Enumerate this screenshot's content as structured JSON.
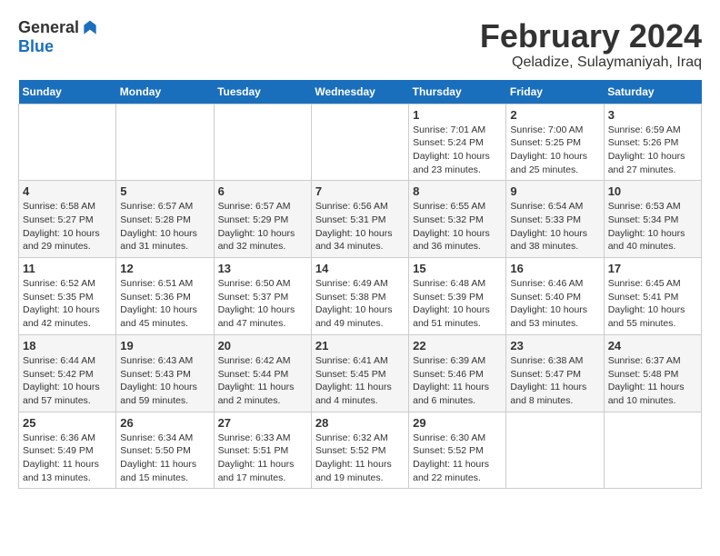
{
  "header": {
    "logo_general": "General",
    "logo_blue": "Blue",
    "month_title": "February 2024",
    "location": "Qeladize, Sulaymaniyah, Iraq"
  },
  "days_of_week": [
    "Sunday",
    "Monday",
    "Tuesday",
    "Wednesday",
    "Thursday",
    "Friday",
    "Saturday"
  ],
  "weeks": [
    [
      {
        "day": "",
        "info": ""
      },
      {
        "day": "",
        "info": ""
      },
      {
        "day": "",
        "info": ""
      },
      {
        "day": "",
        "info": ""
      },
      {
        "day": "1",
        "info": "Sunrise: 7:01 AM\nSunset: 5:24 PM\nDaylight: 10 hours\nand 23 minutes."
      },
      {
        "day": "2",
        "info": "Sunrise: 7:00 AM\nSunset: 5:25 PM\nDaylight: 10 hours\nand 25 minutes."
      },
      {
        "day": "3",
        "info": "Sunrise: 6:59 AM\nSunset: 5:26 PM\nDaylight: 10 hours\nand 27 minutes."
      }
    ],
    [
      {
        "day": "4",
        "info": "Sunrise: 6:58 AM\nSunset: 5:27 PM\nDaylight: 10 hours\nand 29 minutes."
      },
      {
        "day": "5",
        "info": "Sunrise: 6:57 AM\nSunset: 5:28 PM\nDaylight: 10 hours\nand 31 minutes."
      },
      {
        "day": "6",
        "info": "Sunrise: 6:57 AM\nSunset: 5:29 PM\nDaylight: 10 hours\nand 32 minutes."
      },
      {
        "day": "7",
        "info": "Sunrise: 6:56 AM\nSunset: 5:31 PM\nDaylight: 10 hours\nand 34 minutes."
      },
      {
        "day": "8",
        "info": "Sunrise: 6:55 AM\nSunset: 5:32 PM\nDaylight: 10 hours\nand 36 minutes."
      },
      {
        "day": "9",
        "info": "Sunrise: 6:54 AM\nSunset: 5:33 PM\nDaylight: 10 hours\nand 38 minutes."
      },
      {
        "day": "10",
        "info": "Sunrise: 6:53 AM\nSunset: 5:34 PM\nDaylight: 10 hours\nand 40 minutes."
      }
    ],
    [
      {
        "day": "11",
        "info": "Sunrise: 6:52 AM\nSunset: 5:35 PM\nDaylight: 10 hours\nand 42 minutes."
      },
      {
        "day": "12",
        "info": "Sunrise: 6:51 AM\nSunset: 5:36 PM\nDaylight: 10 hours\nand 45 minutes."
      },
      {
        "day": "13",
        "info": "Sunrise: 6:50 AM\nSunset: 5:37 PM\nDaylight: 10 hours\nand 47 minutes."
      },
      {
        "day": "14",
        "info": "Sunrise: 6:49 AM\nSunset: 5:38 PM\nDaylight: 10 hours\nand 49 minutes."
      },
      {
        "day": "15",
        "info": "Sunrise: 6:48 AM\nSunset: 5:39 PM\nDaylight: 10 hours\nand 51 minutes."
      },
      {
        "day": "16",
        "info": "Sunrise: 6:46 AM\nSunset: 5:40 PM\nDaylight: 10 hours\nand 53 minutes."
      },
      {
        "day": "17",
        "info": "Sunrise: 6:45 AM\nSunset: 5:41 PM\nDaylight: 10 hours\nand 55 minutes."
      }
    ],
    [
      {
        "day": "18",
        "info": "Sunrise: 6:44 AM\nSunset: 5:42 PM\nDaylight: 10 hours\nand 57 minutes."
      },
      {
        "day": "19",
        "info": "Sunrise: 6:43 AM\nSunset: 5:43 PM\nDaylight: 10 hours\nand 59 minutes."
      },
      {
        "day": "20",
        "info": "Sunrise: 6:42 AM\nSunset: 5:44 PM\nDaylight: 11 hours\nand 2 minutes."
      },
      {
        "day": "21",
        "info": "Sunrise: 6:41 AM\nSunset: 5:45 PM\nDaylight: 11 hours\nand 4 minutes."
      },
      {
        "day": "22",
        "info": "Sunrise: 6:39 AM\nSunset: 5:46 PM\nDaylight: 11 hours\nand 6 minutes."
      },
      {
        "day": "23",
        "info": "Sunrise: 6:38 AM\nSunset: 5:47 PM\nDaylight: 11 hours\nand 8 minutes."
      },
      {
        "day": "24",
        "info": "Sunrise: 6:37 AM\nSunset: 5:48 PM\nDaylight: 11 hours\nand 10 minutes."
      }
    ],
    [
      {
        "day": "25",
        "info": "Sunrise: 6:36 AM\nSunset: 5:49 PM\nDaylight: 11 hours\nand 13 minutes."
      },
      {
        "day": "26",
        "info": "Sunrise: 6:34 AM\nSunset: 5:50 PM\nDaylight: 11 hours\nand 15 minutes."
      },
      {
        "day": "27",
        "info": "Sunrise: 6:33 AM\nSunset: 5:51 PM\nDaylight: 11 hours\nand 17 minutes."
      },
      {
        "day": "28",
        "info": "Sunrise: 6:32 AM\nSunset: 5:52 PM\nDaylight: 11 hours\nand 19 minutes."
      },
      {
        "day": "29",
        "info": "Sunrise: 6:30 AM\nSunset: 5:52 PM\nDaylight: 11 hours\nand 22 minutes."
      },
      {
        "day": "",
        "info": ""
      },
      {
        "day": "",
        "info": ""
      }
    ]
  ]
}
